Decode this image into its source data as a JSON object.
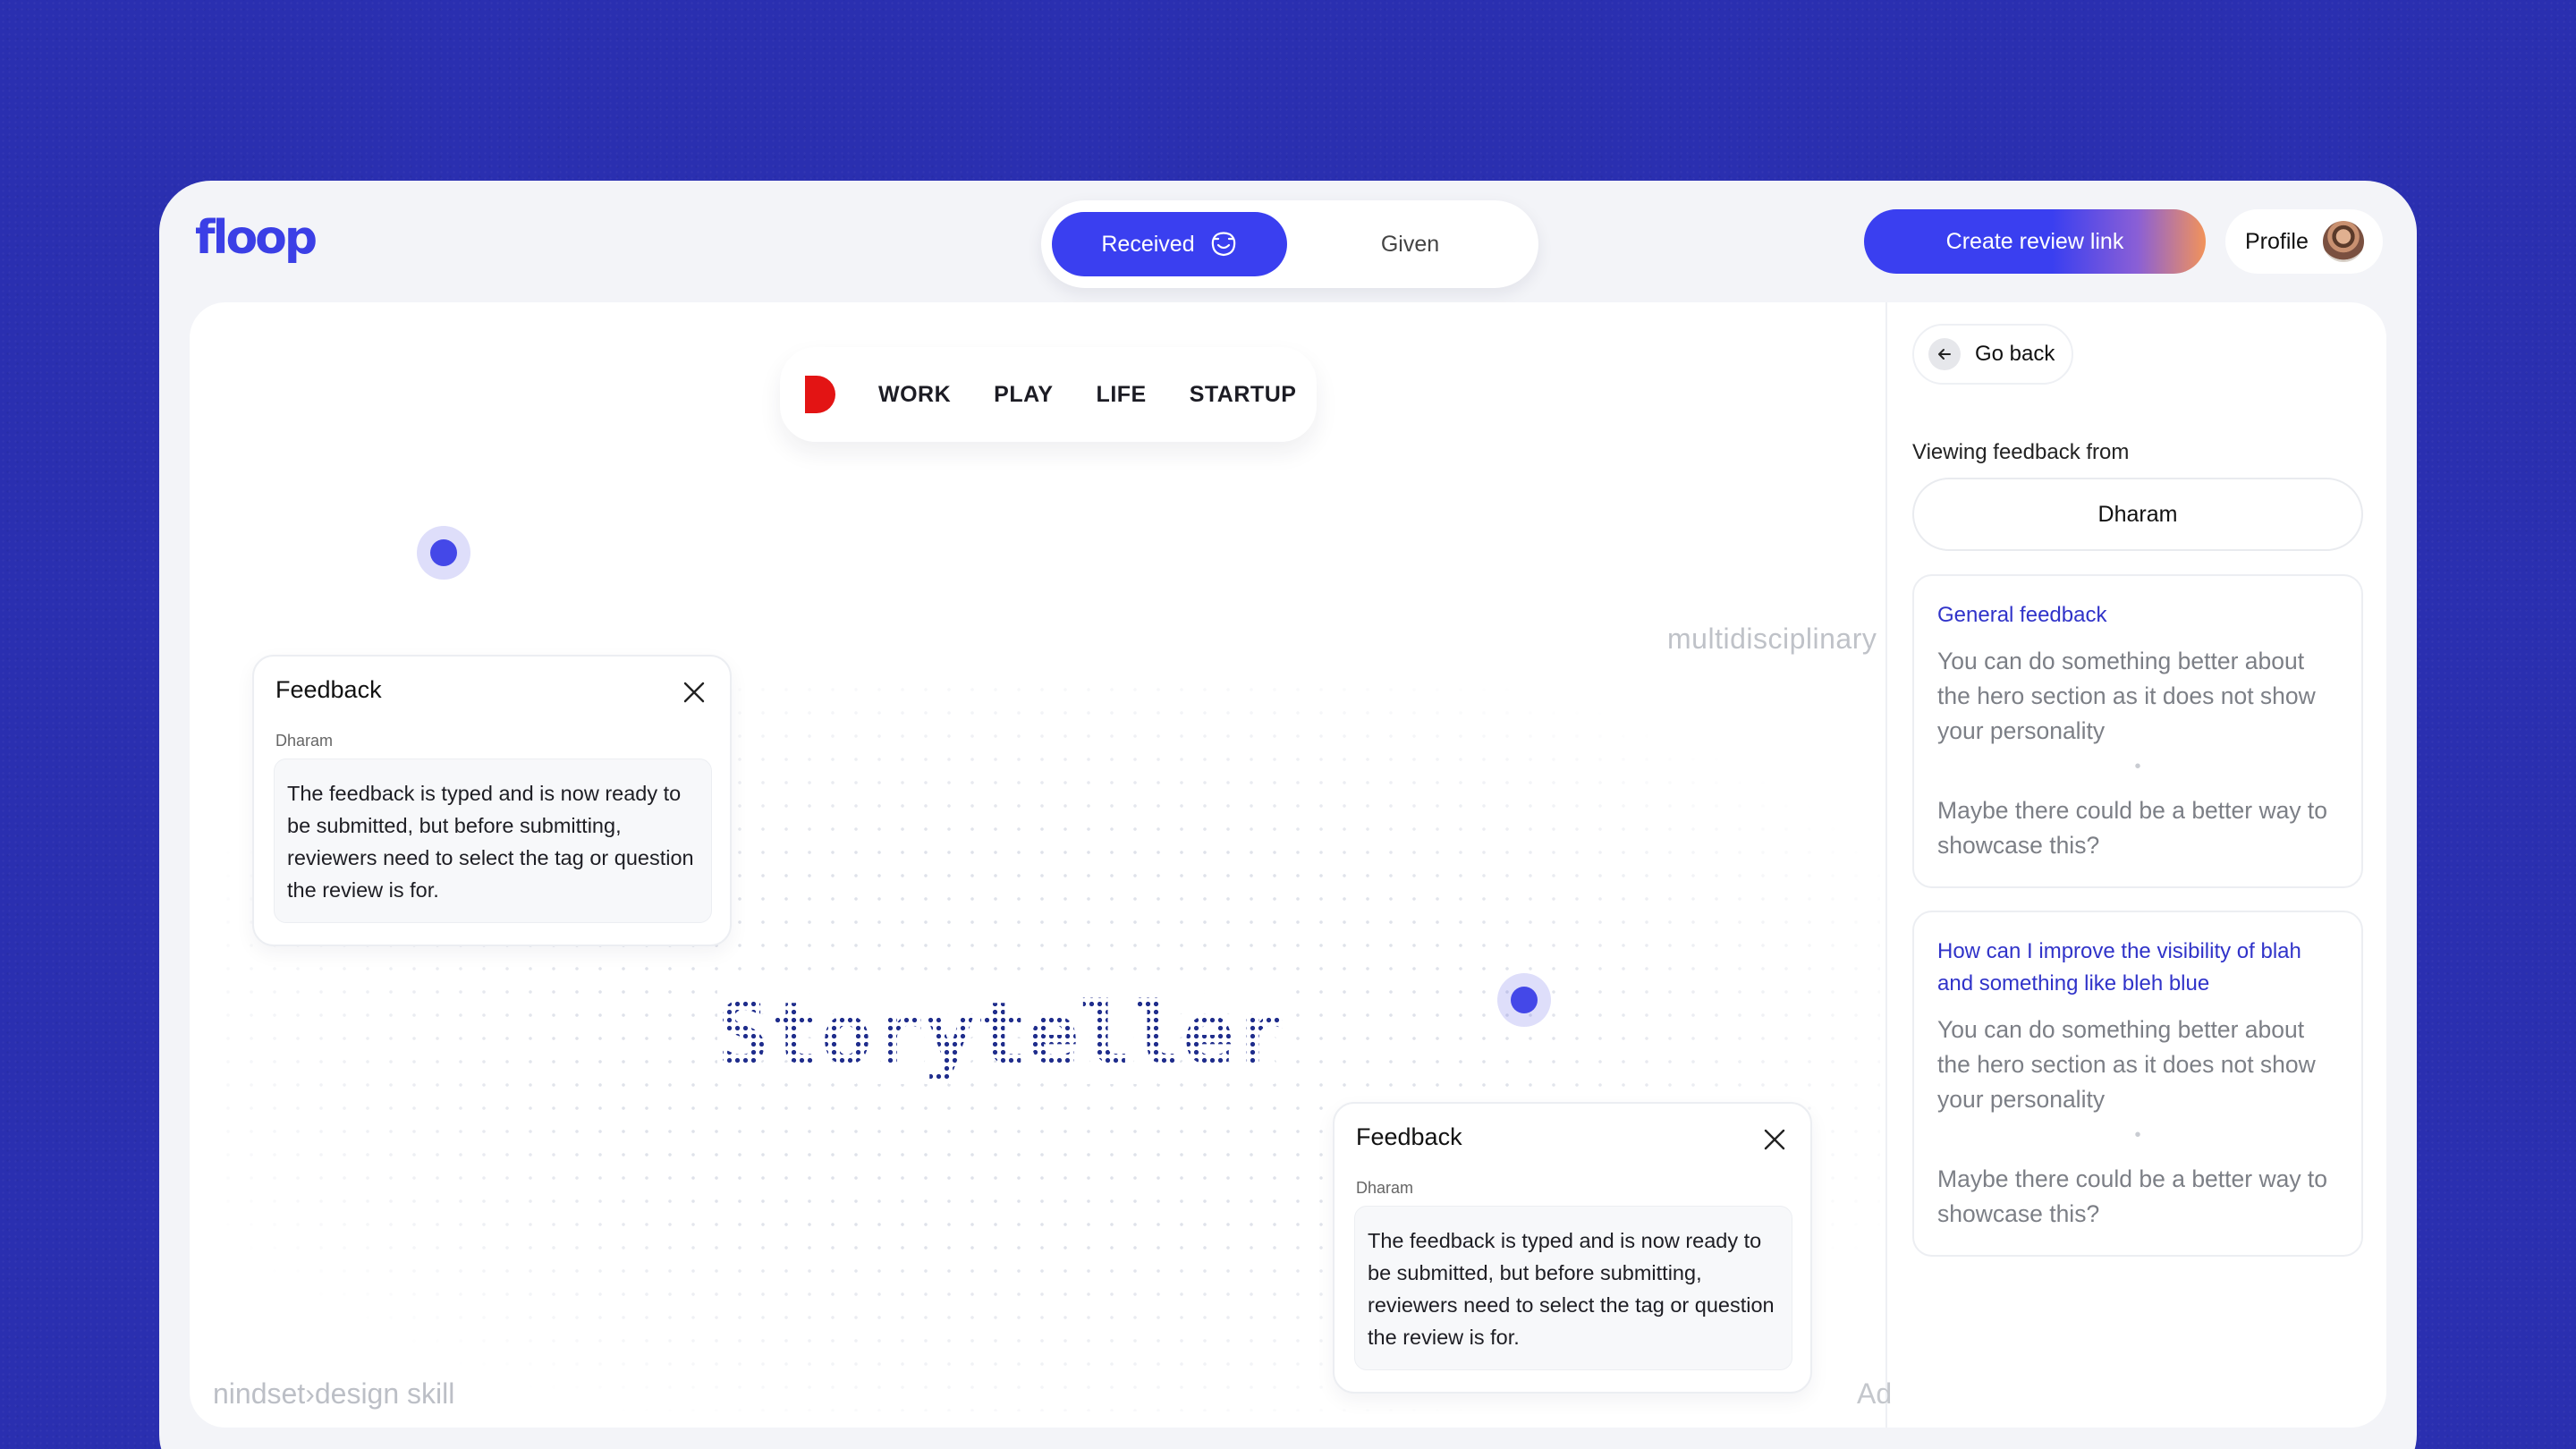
{
  "app": {
    "logo_text": "floop",
    "tabs": [
      {
        "label": "Received",
        "active": true,
        "icon": "smile-icon"
      },
      {
        "label": "Given",
        "active": false
      }
    ],
    "create_button_label": "Create review link",
    "profile_label": "Profile",
    "brand_color": "#3a3ff0"
  },
  "site_preview": {
    "nav": [
      "WORK",
      "PLAY",
      "LIFE",
      "STARTUP"
    ],
    "hero_word": "Storyteller",
    "side_word": "multidisciplinary",
    "footer_left": "nindset›design skill",
    "footer_right": "Ad"
  },
  "feedback_cards": [
    {
      "title": "Feedback",
      "author": "Dharam",
      "text": "The feedback is typed and is now ready to be submitted, but before submitting, reviewers need to select the tag or question the review is for."
    },
    {
      "title": "Feedback",
      "author": "Dharam",
      "text": "The feedback is typed and is now ready to be submitted, but before submitting, reviewers need to select the tag or question the review is for."
    }
  ],
  "sidebar": {
    "back_label": "Go back",
    "viewing_label": "Viewing feedback from",
    "reviewer": "Dharam",
    "questions": [
      {
        "title": "General feedback",
        "comments": [
          "You can do something better about the hero section as it does not show your personality",
          "Maybe there could be a better way to showcase this?"
        ]
      },
      {
        "title": "How can I improve the visibility of blah and something like bleh blue",
        "comments": [
          "You can do something better about the hero section as it does not show your personality",
          "Maybe there could be a better way to showcase this?"
        ]
      }
    ]
  }
}
